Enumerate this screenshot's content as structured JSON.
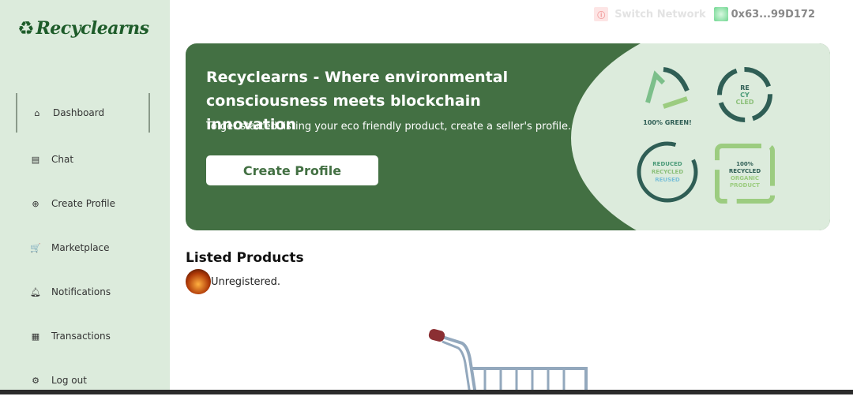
{
  "app": {
    "name": "Recyclearns"
  },
  "sidebar": {
    "items": [
      {
        "label": "Dashboard",
        "icon": "home-icon",
        "glyph": "⌂"
      },
      {
        "label": "Chat",
        "icon": "archive-icon",
        "glyph": "▤"
      },
      {
        "label": "Create Profile",
        "icon": "plus-circle-icon",
        "glyph": "⊕"
      },
      {
        "label": "Marketplace",
        "icon": "cart-icon",
        "glyph": "🛒"
      },
      {
        "label": "Notifications",
        "icon": "bell-icon",
        "glyph": "♫"
      },
      {
        "label": "Transactions",
        "icon": "receipt-icon",
        "glyph": "▦"
      },
      {
        "label": "Log out",
        "icon": "gear-icon",
        "glyph": "⚙"
      }
    ]
  },
  "topbar": {
    "switch_network": "Switch Network",
    "wallet": "0x63...99D172"
  },
  "banner": {
    "title": "Recyclearns - Where environmental consciousness meets blockchain innovation",
    "subtitle": "To get started listing your eco friendly product, create a seller's profile.",
    "button": "Create Profile",
    "badges": [
      "100% GREEN!",
      "RE CY CLED",
      "REDUCED RECYCLED REUSED",
      "100% RECYCLED ORGANIC PRODUCT"
    ]
  },
  "products": {
    "title": "Listed Products",
    "user_status": "Unregistered."
  },
  "colors": {
    "sidebar": "#dcebdc",
    "brand": "#437043"
  }
}
